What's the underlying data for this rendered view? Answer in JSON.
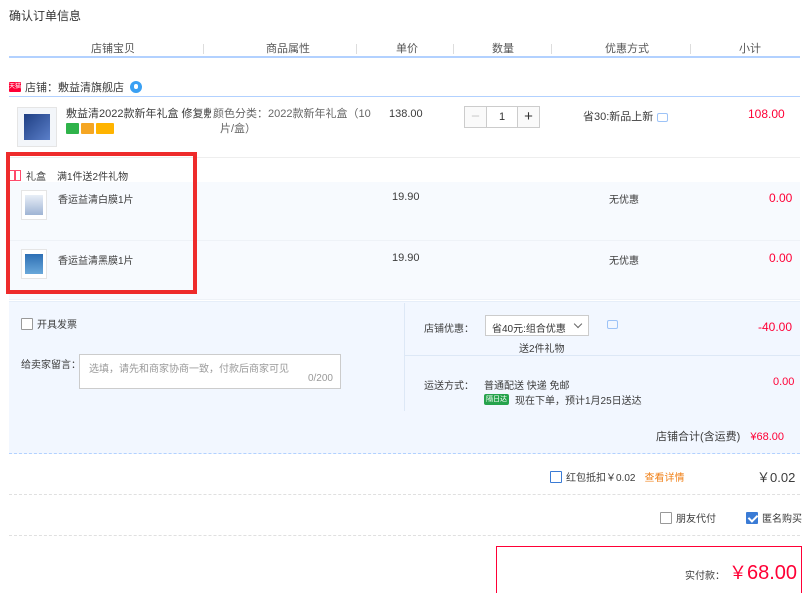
{
  "page": {
    "title": "确认订单信息"
  },
  "columns": [
    "店铺宝贝",
    "商品属性",
    "单价",
    "数量",
    "优惠方式",
    "小计"
  ],
  "store": {
    "badge": "天猫",
    "label": "店铺：敷益清旗舰店"
  },
  "item": {
    "title": "敷益清2022款新年礼盒 修复敷...",
    "sku_line1": "颜色分类：2022款新年礼盒（10",
    "sku_line2": "片/盒）",
    "unit_price": "138.00",
    "quantity": "1",
    "promo": "省30:新品上新",
    "subtotal": "108.00"
  },
  "gift": {
    "tag": "礼盒",
    "rule": "满1件送2件礼物",
    "items": [
      {
        "name": "香运益清白膜1片",
        "price": "19.90",
        "promo": "无优惠",
        "subtotal": "0.00"
      },
      {
        "name": "香运益清黑膜1片",
        "price": "19.90",
        "promo": "无优惠",
        "subtotal": "0.00"
      }
    ]
  },
  "options": {
    "invoice_label": "开具发票",
    "message_label": "给卖家留言：",
    "message_placeholder": "选填，请先和商家协商一致，付款后商家可见",
    "message_count": "0/200",
    "store_discount_label": "店铺优惠：",
    "store_discount_value": "省40元:组合优惠",
    "store_discount_note": "送2件礼物",
    "store_discount_amount": "-40.00",
    "shipping_label": "运送方式：",
    "shipping_method": "普通配送 快递 免邮",
    "delivery_badge": "隔日达",
    "delivery_eta": "现在下单，预计1月25日送达",
    "shipping_amount": "0.00"
  },
  "store_total": {
    "label": "店铺合计(含运费)",
    "amount": "¥68.00"
  },
  "red_packet": {
    "label": "红包抵扣￥0.02",
    "link": "查看详情",
    "amount": "￥0.02"
  },
  "extras": {
    "friend_pay": "朋友代付",
    "anonymous": "匿名购买"
  },
  "payment": {
    "label": "实付款：",
    "currency": "￥",
    "amount": "68.00"
  },
  "colors": {
    "accent_red": "#ff0036",
    "accent_blue": "#3a7bd5",
    "highlight_box": "#ee2b2b",
    "option_bg": "#f2f7ff"
  }
}
